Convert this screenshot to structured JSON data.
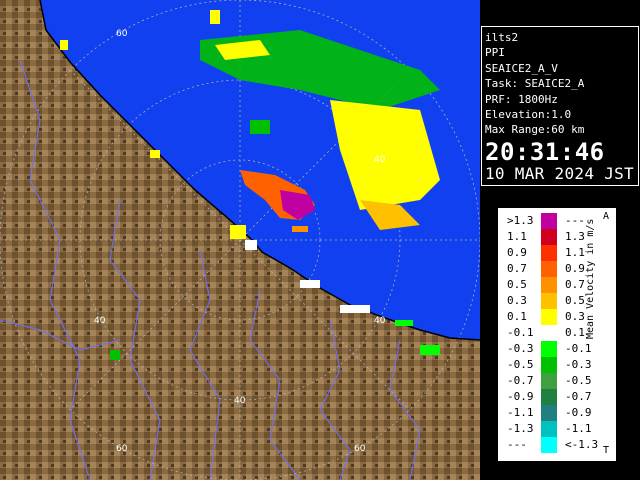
{
  "info": {
    "station": "ilts2",
    "product": "PPI",
    "field": "SEAICE2_A_V",
    "task": "Task: SEAICE2_A",
    "prf": "PRF: 1800Hz",
    "elevation": "Elevation:1.0",
    "max_range": "Max Range:60 km",
    "time": "20:31:46",
    "date": "10 MAR 2024 JST"
  },
  "map": {
    "range_labels": [
      {
        "text": "60",
        "id": "range-label-60-top"
      },
      {
        "text": "40",
        "id": "range-label-40-right"
      },
      {
        "text": "40",
        "id": "range-label-40-east"
      },
      {
        "text": "40",
        "id": "range-label-40-west"
      },
      {
        "text": "40",
        "id": "range-label-40-south"
      },
      {
        "text": "60",
        "id": "range-label-60-sw"
      },
      {
        "text": "60",
        "id": "range-label-60-se"
      }
    ],
    "colors": {
      "sea": "#1040f0",
      "land": "#8a6a40",
      "rivers": "#7070ff"
    }
  },
  "legend": {
    "title": "Mean Velocity in m/s",
    "top_marker": "A",
    "bottom_marker": "T",
    "rows": [
      {
        "left": ">1.3",
        "right": "---",
        "color": "#c000a0"
      },
      {
        "left": "1.1",
        "right": "1.3",
        "color": "#d00020"
      },
      {
        "left": "0.9",
        "right": "1.1",
        "color": "#ff3000"
      },
      {
        "left": "0.7",
        "right": "0.9",
        "color": "#ff6000"
      },
      {
        "left": "0.5",
        "right": "0.7",
        "color": "#ff9000"
      },
      {
        "left": "0.3",
        "right": "0.5",
        "color": "#ffc000"
      },
      {
        "left": "0.1",
        "right": "0.3",
        "color": "#ffff00"
      },
      {
        "left": "-0.1",
        "right": "0.1",
        "color": "#ffffff"
      },
      {
        "left": "-0.3",
        "right": "-0.1",
        "color": "#00ff00"
      },
      {
        "left": "-0.5",
        "right": "-0.3",
        "color": "#00c000"
      },
      {
        "left": "-0.7",
        "right": "-0.5",
        "color": "#40a040"
      },
      {
        "left": "-0.9",
        "right": "-0.7",
        "color": "#208040"
      },
      {
        "left": "-1.1",
        "right": "-0.9",
        "color": "#208080"
      },
      {
        "left": "-1.3",
        "right": "-1.1",
        "color": "#00c0c0"
      },
      {
        "left": "---",
        "right": "<-1.3",
        "color": "#00ffff"
      }
    ]
  }
}
